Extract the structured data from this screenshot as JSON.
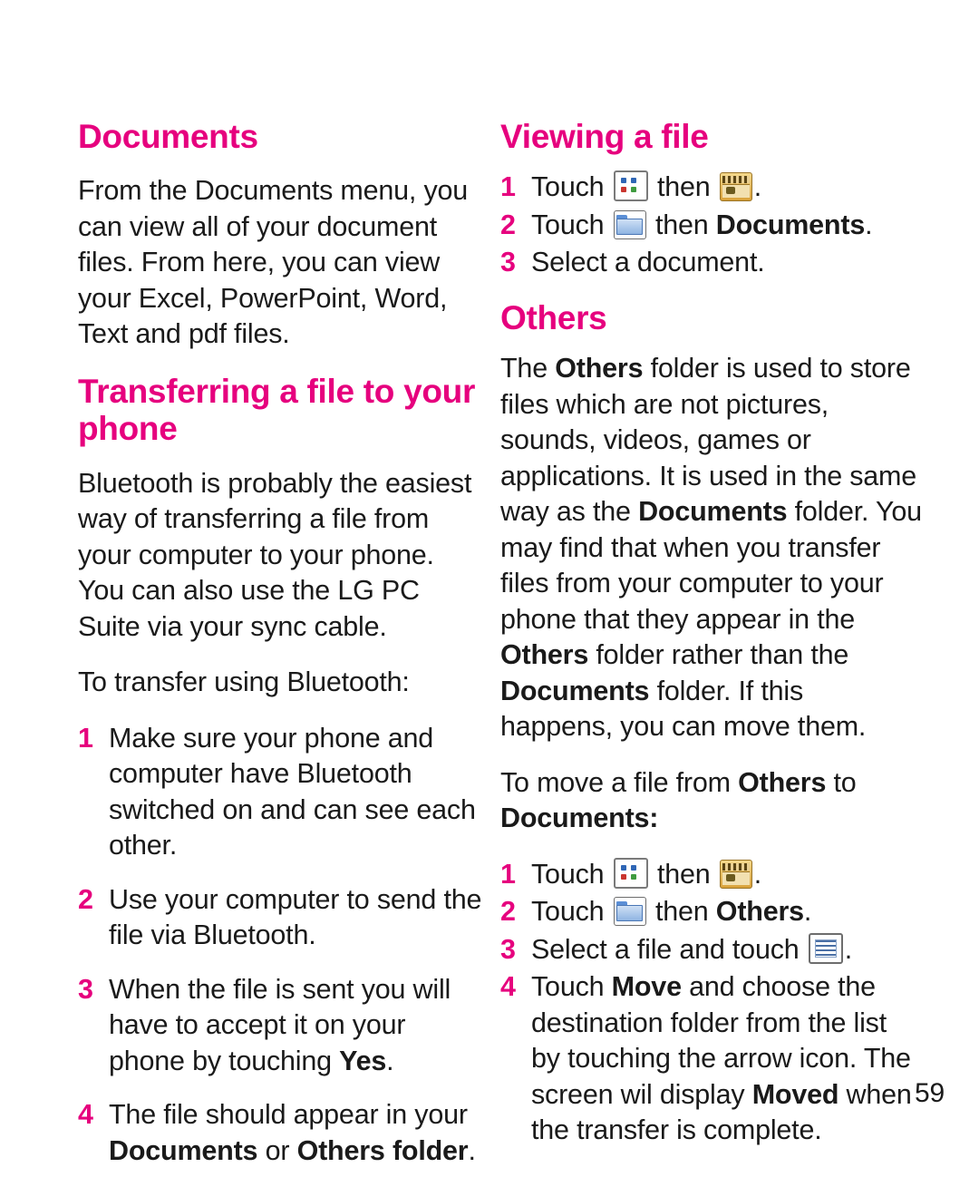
{
  "page": {
    "number": "59"
  },
  "left_column": {
    "heading_documents": "Documents",
    "para_documents": "From the Documents menu, you can view all of your document files. From here, you can view your Excel, PowerPoint, Word, Text and pdf files.",
    "heading_transferring": "Transferring a file to your phone",
    "para_bluetooth": "Bluetooth is probably the easiest way of transferring a file from your computer to your phone. You can also use the LG PC Suite via your sync cable.",
    "para_to_transfer": "To transfer using Bluetooth:",
    "steps": [
      {
        "num": "1",
        "text": "Make sure your phone and computer have Bluetooth switched on and can see each other."
      },
      {
        "num": "2",
        "text": "Use your computer to send the file via Bluetooth."
      },
      {
        "num": "3",
        "text_before": "When the file is sent you will have to accept it on your phone by touching ",
        "bold": "Yes",
        "text_after": "."
      },
      {
        "num": "4",
        "text_before": "The file should appear in your ",
        "bold1": "Documents",
        "mid": " or ",
        "bold2": "Others folder",
        "text_after": "."
      }
    ]
  },
  "right_column": {
    "heading_viewing": "Viewing a file",
    "viewing_steps": [
      {
        "num": "1",
        "prefix": "Touch",
        "icon1": "grid-apps-icon",
        "middle": "then",
        "icon2": "media-folder-icon",
        "suffix": "."
      },
      {
        "num": "2",
        "prefix": "Touch",
        "icon1": "folder-icon",
        "middle": "then ",
        "bold": "Documents",
        "suffix": "."
      },
      {
        "num": "3",
        "text": "Select a document."
      }
    ],
    "heading_others": "Others",
    "para_others_1_a": "The ",
    "para_others_1_b": "Others",
    "para_others_1_c": " folder is used to store files which are not pictures, sounds, videos, games or applications. It is used in the same way as the ",
    "para_others_1_d": "Documents",
    "para_others_1_e": " folder. You may find that when you transfer files from your computer to your phone that they appear in the ",
    "para_others_1_f": "Others",
    "para_others_1_g": " folder rather than the ",
    "para_others_1_h": "Documents",
    "para_others_1_i": " folder. If this happens, you can move them.",
    "para_move_a": "To move a file from ",
    "para_move_b": "Others",
    "para_move_c": " to ",
    "para_move_d": "Documents:",
    "move_steps": [
      {
        "num": "1",
        "prefix": "Touch",
        "icon1": "grid-apps-icon",
        "middle": "then",
        "icon2": "media-folder-icon",
        "suffix": "."
      },
      {
        "num": "2",
        "prefix": "Touch",
        "icon1": "folder-icon",
        "middle": "then ",
        "bold": "Others",
        "suffix": "."
      },
      {
        "num": "3",
        "prefix": "Select a file and touch",
        "icon1": "document-icon",
        "suffix": "."
      },
      {
        "num": "4",
        "text_before": "Touch ",
        "bold1": "Move",
        "mid": " and choose the destination folder from the list by touching the arrow icon. The screen wil display ",
        "bold2": "Moved",
        "text_after": " when the transfer is complete."
      }
    ]
  },
  "colors": {
    "accent": "#e6007e",
    "text": "#1a1a1a",
    "background": "#ffffff"
  }
}
